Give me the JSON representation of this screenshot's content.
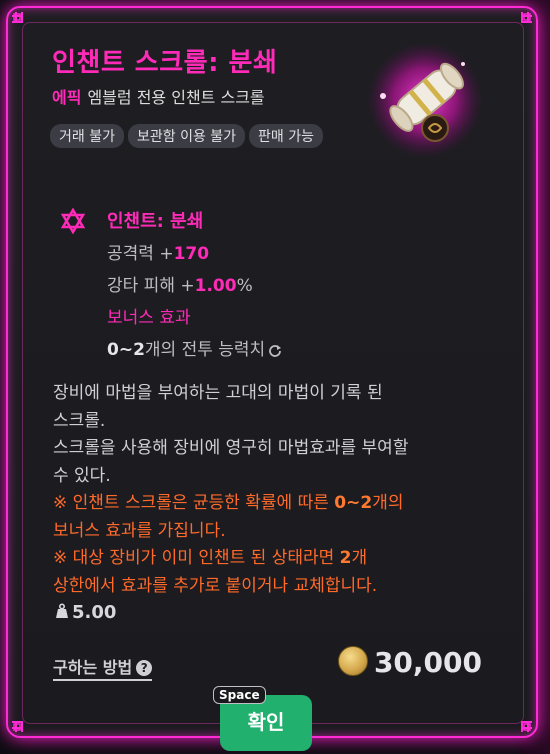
{
  "item": {
    "title": "인챈트 스크롤: 분쇄",
    "grade": "에픽",
    "type": "엠블럼 전용 인챈트 스크롤",
    "tags": [
      "거래 불가",
      "보관함 이용 불가",
      "판매 가능"
    ]
  },
  "enchant": {
    "name": "인챈트: 분쇄",
    "stat1_label": "공격력 +",
    "stat1_value": "170",
    "stat2_label": "강타 피해 +",
    "stat2_value": "1.00",
    "stat2_unit": "%",
    "bonus_title": "보너스 효과",
    "bonus_count": "0~2",
    "bonus_text": "개의 전투 능력치"
  },
  "description": {
    "line1": "장비에 마법을 부여하는 고대의 마법이 기록 된",
    "line2": "스크롤.",
    "line3": "스크롤을 사용해 장비에 영구히 마법효과를 부여할",
    "line4": "수 있다.",
    "warn1_a": "※ 인챈트 스크롤은 균등한 확률에 따른 ",
    "warn1_b": "0~2",
    "warn1_c": "개의",
    "warn1_d": "보너스 효과를 가집니다.",
    "warn2_a": "※ 대상 장비가 이미 인챈트 된 상태라면 ",
    "warn2_b": "2",
    "warn2_c": "개",
    "warn2_d": "상한에서 효과를 추가로 붙이거나 교체합니다."
  },
  "weight": "5.00",
  "howto_label": "구하는 방법",
  "price": "30,000",
  "confirm": {
    "key": "Space",
    "label": "확인"
  },
  "colors": {
    "accent": "#ff2bb8",
    "frame": "#ff2bd6",
    "warning": "#ff6a2a",
    "confirm": "#21b06e"
  },
  "icons": [
    "hexagram-icon",
    "weight-icon",
    "help-icon",
    "coin-icon",
    "refresh-icon",
    "scroll-item-icon"
  ]
}
